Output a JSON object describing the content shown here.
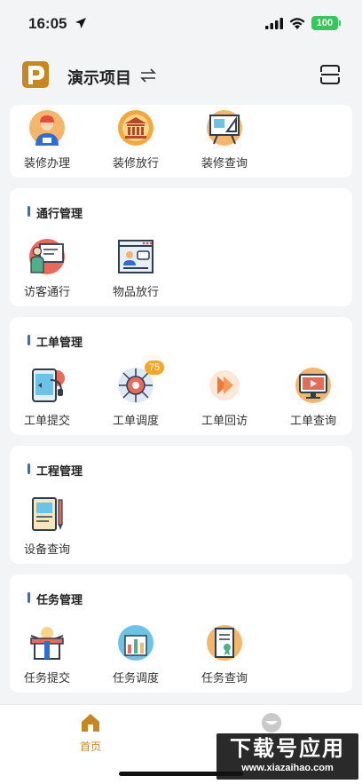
{
  "status_bar": {
    "time": "16:05",
    "battery": "100"
  },
  "header": {
    "project_name": "演示项目"
  },
  "sections": {
    "renovation": {
      "items": [
        {
          "label": "装修办理",
          "icon": "worker-icon"
        },
        {
          "label": "装修放行",
          "icon": "bank-icon"
        },
        {
          "label": "装修查询",
          "icon": "blueprint-icon"
        }
      ]
    },
    "access": {
      "title": "通行管理",
      "items": [
        {
          "label": "访客通行",
          "icon": "visitor-icon"
        },
        {
          "label": "物品放行",
          "icon": "window-icon"
        }
      ]
    },
    "workorder": {
      "title": "工单管理",
      "items": [
        {
          "label": "工单提交",
          "icon": "tablet-headset-icon"
        },
        {
          "label": "工单调度",
          "icon": "gear-network-icon",
          "badge": "75"
        },
        {
          "label": "工单回访",
          "icon": "play-forward-icon"
        },
        {
          "label": "工单查询",
          "icon": "monitor-icon"
        }
      ]
    },
    "engineering": {
      "title": "工程管理",
      "items": [
        {
          "label": "设备查询",
          "icon": "notepad-pen-icon"
        }
      ]
    },
    "task": {
      "title": "任务管理",
      "items": [
        {
          "label": "任务提交",
          "icon": "gift-box-icon"
        },
        {
          "label": "任务调度",
          "icon": "bar-chart-icon"
        },
        {
          "label": "任务查询",
          "icon": "scroll-icon"
        }
      ]
    }
  },
  "tabbar": {
    "home_label": "首页",
    "active_color": "#c8871e"
  },
  "watermark": {
    "main": "下载号应用",
    "sub": "www.xiazaihao.com"
  },
  "colors": {
    "accent_blue": "#2b6fd6",
    "badge": "#f5a623",
    "brand_gold": "#c8871e"
  }
}
